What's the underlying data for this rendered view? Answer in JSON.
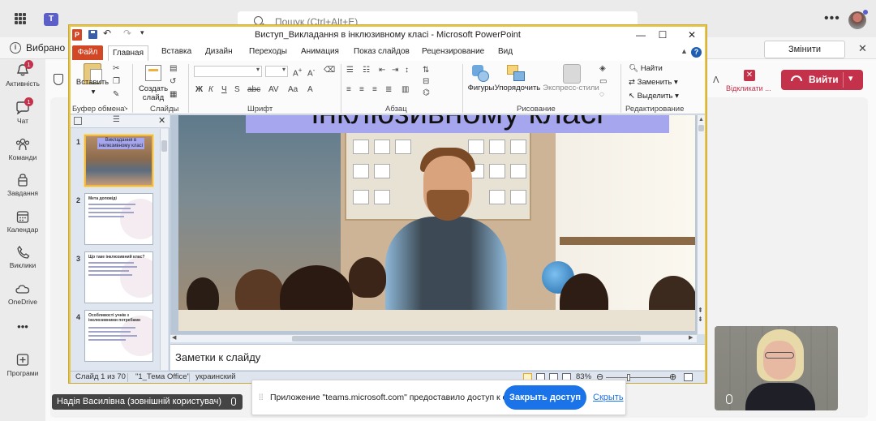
{
  "teams": {
    "search_placeholder": "Пошук (Ctrl+Alt+E)",
    "more_label": "•••",
    "bar_text": "Вибрано с",
    "change_settings_label": "Змінити параметри",
    "rail": [
      {
        "label": "Активність",
        "badge": "1",
        "icon": "bell-icon"
      },
      {
        "label": "Чат",
        "badge": "1",
        "icon": "chat-icon"
      },
      {
        "label": "Команди",
        "badge": "",
        "icon": "teams-icon"
      },
      {
        "label": "Завдання",
        "badge": "",
        "icon": "assignments-icon"
      },
      {
        "label": "Календар",
        "badge": "",
        "icon": "calendar-icon"
      },
      {
        "label": "Виклики",
        "badge": "",
        "icon": "phone-icon"
      },
      {
        "label": "OneDrive",
        "badge": "",
        "icon": "cloud-icon"
      },
      {
        "label": "",
        "badge": "",
        "icon": "more-icon"
      },
      {
        "label": "Програми",
        "badge": "",
        "icon": "apps-icon"
      }
    ],
    "hangup_label": "Відкликати ...",
    "leave_label": "Вийти",
    "participant_name": "Надія Василівна (зовнішній користувач)",
    "accent": "#5b5fc7",
    "danger": "#c4314b"
  },
  "share_bar": {
    "message": "Приложение \"teams.microsoft.com\" предоставило доступ к окну.",
    "stop_label": "Закрыть доступ",
    "hide_label": "Скрыть",
    "accent": "#1a73e8"
  },
  "ppt": {
    "title": "Виступ_Викладання в інклюзивному класі  -  Microsoft PowerPoint",
    "tabs": {
      "file": "Файл",
      "home": "Главная",
      "insert": "Вставка",
      "design": "Дизайн",
      "transitions": "Переходы",
      "animations": "Анимация",
      "slideshow": "Показ слайдов",
      "review": "Рецензирование",
      "view": "Вид"
    },
    "ribbon": {
      "paste": "Вставить",
      "new_slide": "Создать слайд",
      "shapes": "Фигуры",
      "arrange": "Упорядочить",
      "quick_styles": "Экспресс-стили",
      "find": "Найти",
      "replace": "Заменить",
      "select": "Выделить",
      "groups": {
        "clipboard": "Буфер обмена",
        "slides": "Слайды",
        "font": "Шрифт",
        "paragraph": "Абзац",
        "drawing": "Рисование",
        "editing": "Редактирование"
      }
    },
    "thumbnails": [
      {
        "num": "1",
        "title": "Викладання в інклюзивному класі"
      },
      {
        "num": "2",
        "title": "Мета доповіді"
      },
      {
        "num": "3",
        "title": "Що таке інклюзивний клас?"
      },
      {
        "num": "4",
        "title": "Особливості учнів з інклюзивними потребами"
      }
    ],
    "slide_title": "інклюзивному класі",
    "notes_placeholder": "Заметки к слайду",
    "status": {
      "slide_info": "Слайд 1 из 70",
      "theme": "\"1_Тема Office\"",
      "language": "украинский",
      "zoom": "83%"
    }
  }
}
